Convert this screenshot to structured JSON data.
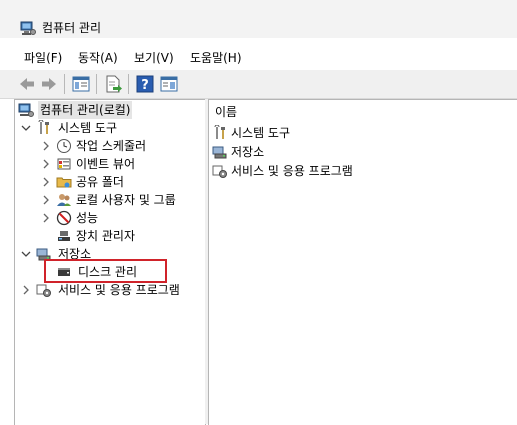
{
  "window": {
    "title": "컴퓨터 관리"
  },
  "menu": [
    "파일(F)",
    "동작(A)",
    "보기(V)",
    "도움말(H)"
  ],
  "toolbar": {
    "buttons": [
      "back-icon",
      "forward-icon",
      "show-hide-tree-icon",
      "export-list-icon",
      "help-icon",
      "properties-pane-icon"
    ]
  },
  "tree": {
    "root": "컴퓨터 관리(로컬)",
    "system_tools": {
      "label": "시스템 도구",
      "children": [
        "작업 스케줄러",
        "이벤트 뷰어",
        "공유 폴더",
        "로컬 사용자 및 그룹",
        "성능",
        "장치 관리자"
      ]
    },
    "storage": {
      "label": "저장소",
      "children": [
        "디스크 관리"
      ]
    },
    "services": "서비스 및 응용 프로그램"
  },
  "list": {
    "header": "이름",
    "items": [
      "시스템 도구",
      "저장소",
      "서비스 및 응용 프로그램"
    ]
  },
  "colors": {
    "highlight": "#d0232a",
    "selection": "#e5e5e5"
  }
}
